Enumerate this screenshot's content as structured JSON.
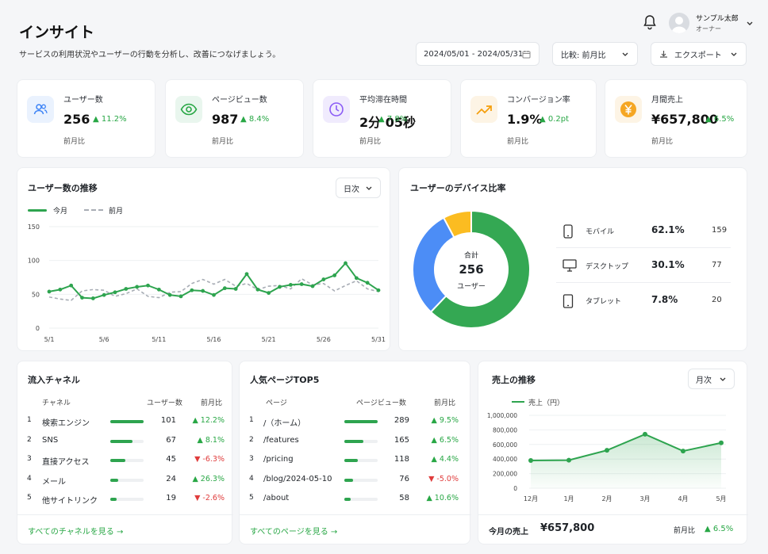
{
  "header": {
    "title": "インサイト",
    "subtitle": "サービスの利用状況やユーザーの行動を分析し、改善につなげましょう。",
    "user_name": "サンプル太郎",
    "user_role": "オーナー",
    "date_range": "2024/05/01 - 2024/05/31",
    "compare_label": "比較: 前月比",
    "export_label": "エクスポート"
  },
  "kpis": [
    {
      "title": "ユーザー数",
      "value": "256",
      "delta": "▲ 11.2%",
      "sub": "前月比",
      "icon": "users-icon",
      "color": "#3b82f6"
    },
    {
      "title": "ページビュー数",
      "value": "987",
      "delta": "▲ 8.4%",
      "sub": "前月比",
      "icon": "eye-icon",
      "color": "#28a745"
    },
    {
      "title": "平均滞在時間",
      "value": "2分 05秒",
      "delta": "▲ 7.8%",
      "sub": "前月比",
      "icon": "clock-icon",
      "color": "#8b5cf6"
    },
    {
      "title": "コンバージョン率",
      "value": "1.9%",
      "delta": "▲ 0.2pt",
      "sub": "前月比",
      "icon": "trend-up-icon",
      "color": "#f59e0b"
    },
    {
      "title": "月間売上",
      "value": "¥657,800",
      "delta": "▲ 6.5%",
      "sub": "前月比",
      "icon": "yen-icon",
      "color": "#f5a623"
    }
  ],
  "user_trend": {
    "title": "ユーザー数の推移",
    "period": "日次",
    "legend_current": "今月",
    "legend_previous": "前月"
  },
  "device": {
    "title": "ユーザーのデバイス比率",
    "center_label": "合計",
    "center_value": "256",
    "center_unit": "ユーザー",
    "rows": [
      {
        "name": "モバイル",
        "pct": "62.1%",
        "count": "159",
        "icon": "smartphone-icon"
      },
      {
        "name": "デスクトップ",
        "pct": "30.1%",
        "count": "77",
        "icon": "monitor-icon"
      },
      {
        "name": "タブレット",
        "pct": "7.8%",
        "count": "20",
        "icon": "tablet-icon"
      }
    ]
  },
  "channels": {
    "title": "流入チャネル",
    "col_channel": "チャネル",
    "col_users": "ユーザー数",
    "col_change": "前月比",
    "rows": [
      {
        "rank": "1",
        "name": "検索エンジン",
        "value": "101",
        "change": "▲ 12.2%",
        "up": true,
        "ratio": 1.0
      },
      {
        "rank": "2",
        "name": "SNS",
        "value": "67",
        "change": "▲ 8.1%",
        "up": true,
        "ratio": 0.66
      },
      {
        "rank": "3",
        "name": "直接アクセス",
        "value": "45",
        "change": "▼ -6.3%",
        "up": false,
        "ratio": 0.45
      },
      {
        "rank": "4",
        "name": "メール",
        "value": "24",
        "change": "▲ 26.3%",
        "up": true,
        "ratio": 0.24
      },
      {
        "rank": "5",
        "name": "他サイトリンク",
        "value": "19",
        "change": "▼ -2.6%",
        "up": false,
        "ratio": 0.19
      }
    ],
    "link": "すべてのチャネルを見る →"
  },
  "pages": {
    "title": "人気ページTOP5",
    "col_page": "ページ",
    "col_views": "ページビュー数",
    "col_change": "前月比",
    "rows": [
      {
        "rank": "1",
        "name": "/（ホーム）",
        "value": "289",
        "change": "▲ 9.5%",
        "up": true,
        "ratio": 1.0
      },
      {
        "rank": "2",
        "name": "/features",
        "value": "165",
        "change": "▲ 6.5%",
        "up": true,
        "ratio": 0.57
      },
      {
        "rank": "3",
        "name": "/pricing",
        "value": "118",
        "change": "▲ 4.4%",
        "up": true,
        "ratio": 0.41
      },
      {
        "rank": "4",
        "name": "/blog/2024-05-10",
        "value": "76",
        "change": "▼ -5.0%",
        "up": false,
        "ratio": 0.26
      },
      {
        "rank": "5",
        "name": "/about",
        "value": "58",
        "change": "▲ 10.6%",
        "up": true,
        "ratio": 0.2
      }
    ],
    "link": "すべてのページを見る →"
  },
  "sales": {
    "title": "売上の推移",
    "period": "月次",
    "legend": "売上（円）",
    "total_label": "今月の売上",
    "total_value": "¥657,800",
    "compare_label": "前月比",
    "compare_value": "▲ 6.5%"
  },
  "chart_data": [
    {
      "type": "line",
      "x": [
        "5/1",
        "5/2",
        "5/3",
        "5/4",
        "5/5",
        "5/6",
        "5/7",
        "5/8",
        "5/9",
        "5/10",
        "5/11",
        "5/12",
        "5/13",
        "5/14",
        "5/15",
        "5/16",
        "5/17",
        "5/18",
        "5/19",
        "5/20",
        "5/21",
        "5/22",
        "5/23",
        "5/24",
        "5/25",
        "5/26",
        "5/27",
        "5/28",
        "5/29",
        "5/30",
        "5/31"
      ],
      "xticks": [
        "5/1",
        "5/6",
        "5/11",
        "5/16",
        "5/21",
        "5/26",
        "5/31"
      ],
      "ylim": [
        0,
        150
      ],
      "yticks": [
        0,
        50,
        100,
        150
      ],
      "series": [
        {
          "name": "今月",
          "color": "#2ea44f",
          "values": [
            54,
            57,
            63,
            45,
            44,
            49,
            53,
            58,
            61,
            63,
            57,
            49,
            47,
            56,
            55,
            49,
            59,
            58,
            80,
            57,
            52,
            61,
            64,
            65,
            62,
            72,
            78,
            96,
            74,
            67,
            56
          ]
        },
        {
          "name": "前月",
          "color": "#a8adb5",
          "values": [
            46,
            43,
            41,
            55,
            57,
            56,
            47,
            51,
            58,
            47,
            45,
            53,
            54,
            66,
            72,
            65,
            72,
            62,
            66,
            57,
            62,
            63,
            58,
            73,
            64,
            66,
            55,
            63,
            70,
            58,
            54
          ]
        }
      ]
    },
    {
      "type": "pie",
      "categories": [
        "モバイル",
        "デスクトップ",
        "タブレット"
      ],
      "values": [
        62.1,
        30.1,
        7.8
      ],
      "colors": [
        "#34a853",
        "#4c8df6",
        "#fbbc21"
      ]
    },
    {
      "type": "area",
      "categories": [
        "12月",
        "1月",
        "2月",
        "3月",
        "4月",
        "5月"
      ],
      "series": [
        {
          "name": "売上（円）",
          "color": "#2ea44f",
          "values": [
            380000,
            385000,
            520000,
            740000,
            510000,
            622000
          ]
        }
      ],
      "ylim": [
        0,
        1000000
      ],
      "yticks": [
        "0",
        "200,000",
        "400,000",
        "600,000",
        "800,000",
        "1,000,000"
      ]
    }
  ]
}
